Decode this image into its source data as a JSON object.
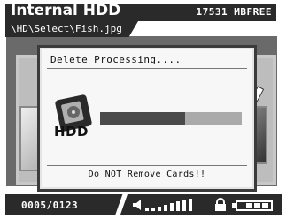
{
  "header": {
    "title": "Internal HDD",
    "free_space": "17531 MBFREE",
    "path": "\\HD\\Select\\Fish.jpg"
  },
  "dialog": {
    "title": "Delete Processing....",
    "icon_label": "HDD",
    "progress": 0.6,
    "warning": "Do NOT Remove Cards!!"
  },
  "footer": {
    "counter": "0005/0123",
    "battery_level": 0.75
  },
  "icons": {
    "drive": "hdd-icon",
    "volume": "volume-icon",
    "lock": "lock-icon",
    "battery": "battery-icon"
  }
}
